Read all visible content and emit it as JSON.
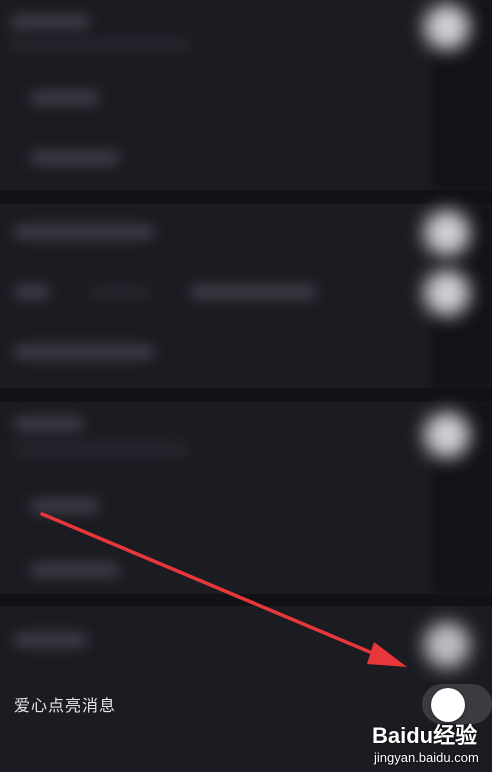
{
  "settings": {
    "visible_row": {
      "label": "爱心点亮消息",
      "toggle_on": false
    }
  },
  "annotation": {
    "arrow_color": "#e8373a",
    "points_to": "toggle-switch"
  },
  "watermark": {
    "brand": "Baidu经验",
    "url": "jingyan.baidu.com"
  },
  "colors": {
    "background": "#17171d",
    "text": "#e6e6ea",
    "toggle_track": "#3b3b42",
    "toggle_knob": "#ffffff"
  }
}
